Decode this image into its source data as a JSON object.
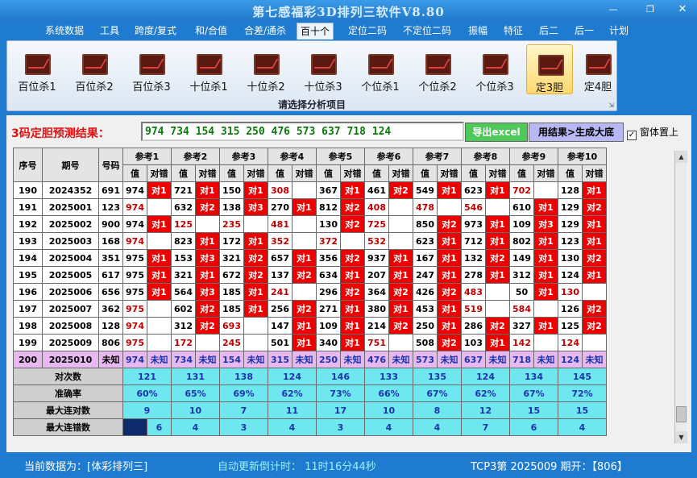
{
  "window": {
    "title": "第七感福彩3D排列三软件V8.80"
  },
  "menu": [
    "系统数据",
    "工具",
    "跨度/复式",
    "和/合值",
    "合差/通杀",
    "百十个",
    "定位二码",
    "不定位二码",
    "振幅",
    "特征",
    "后二",
    "后一",
    "计划"
  ],
  "active_menu": "百十个",
  "ribbon": {
    "buttons": [
      "百位杀1",
      "百位杀2",
      "百位杀3",
      "十位杀1",
      "十位杀2",
      "十位杀3",
      "个位杀1",
      "个位杀2",
      "个位杀3",
      "定3胆",
      "定4胆"
    ],
    "selected": "定3胆",
    "caption": "请选择分析项目"
  },
  "prediction": {
    "label": "3码定胆预测结果：",
    "value": "974 734 154 315 250 476 573 637 718 124"
  },
  "buttons": {
    "export": "导出excel",
    "gen": "用结果>生成大底"
  },
  "checkbox": {
    "label": "窗体置上",
    "checked": true
  },
  "table": {
    "h_seq": "序号",
    "h_period": "期号",
    "h_num": "号码",
    "refs": [
      "参考1",
      "参考2",
      "参考3",
      "参考4",
      "参考5",
      "参考6",
      "参考7",
      "参考8",
      "参考9",
      "参考10"
    ],
    "sub_val": "值",
    "sub_hit": "对错",
    "rows": [
      {
        "seq": "190",
        "period": "2024352",
        "num": "691",
        "cells": [
          [
            "974",
            "对1",
            0
          ],
          [
            "721",
            "对1",
            0
          ],
          [
            "150",
            "对1",
            0
          ],
          [
            "308",
            "",
            1
          ],
          [
            "367",
            "对1",
            0
          ],
          [
            "461",
            "对2",
            0
          ],
          [
            "549",
            "对1",
            0
          ],
          [
            "623",
            "对1",
            0
          ],
          [
            "702",
            "",
            1
          ],
          [
            "128",
            "对1",
            0
          ]
        ]
      },
      {
        "seq": "191",
        "period": "2025001",
        "num": "123",
        "cells": [
          [
            "974",
            "",
            1
          ],
          [
            "632",
            "对2",
            0
          ],
          [
            "138",
            "对3",
            0
          ],
          [
            "270",
            "对1",
            0
          ],
          [
            "812",
            "对2",
            0
          ],
          [
            "408",
            "",
            1
          ],
          [
            "478",
            "",
            1
          ],
          [
            "546",
            "",
            1
          ],
          [
            "610",
            "对1",
            0
          ],
          [
            "129",
            "对2",
            0
          ]
        ]
      },
      {
        "seq": "192",
        "period": "2025002",
        "num": "900",
        "cells": [
          [
            "974",
            "对1",
            0
          ],
          [
            "125",
            "",
            1
          ],
          [
            "235",
            "",
            1
          ],
          [
            "481",
            "",
            1
          ],
          [
            "130",
            "对2",
            0
          ],
          [
            "725",
            "",
            1
          ],
          [
            "850",
            "对2",
            0
          ],
          [
            "973",
            "对1",
            0
          ],
          [
            "109",
            "对3",
            0
          ],
          [
            "129",
            "对1",
            0
          ]
        ]
      },
      {
        "seq": "193",
        "period": "2025003",
        "num": "168",
        "cells": [
          [
            "974",
            "",
            1
          ],
          [
            "823",
            "对1",
            0
          ],
          [
            "172",
            "对1",
            0
          ],
          [
            "352",
            "",
            1
          ],
          [
            "372",
            "",
            1
          ],
          [
            "532",
            "",
            1
          ],
          [
            "623",
            "对1",
            0
          ],
          [
            "712",
            "对1",
            0
          ],
          [
            "802",
            "对1",
            0
          ],
          [
            "123",
            "对1",
            0
          ]
        ]
      },
      {
        "seq": "194",
        "period": "2025004",
        "num": "351",
        "cells": [
          [
            "975",
            "对1",
            0
          ],
          [
            "153",
            "对3",
            0
          ],
          [
            "321",
            "对2",
            0
          ],
          [
            "657",
            "对1",
            0
          ],
          [
            "356",
            "对2",
            0
          ],
          [
            "937",
            "对1",
            0
          ],
          [
            "167",
            "对1",
            0
          ],
          [
            "132",
            "对2",
            0
          ],
          [
            "149",
            "对1",
            0
          ],
          [
            "130",
            "对2",
            0
          ]
        ]
      },
      {
        "seq": "195",
        "period": "2025005",
        "num": "617",
        "cells": [
          [
            "975",
            "对1",
            0
          ],
          [
            "321",
            "对1",
            0
          ],
          [
            "672",
            "对2",
            0
          ],
          [
            "137",
            "对2",
            0
          ],
          [
            "634",
            "对1",
            0
          ],
          [
            "207",
            "对1",
            0
          ],
          [
            "247",
            "对1",
            0
          ],
          [
            "278",
            "对1",
            0
          ],
          [
            "312",
            "对1",
            0
          ],
          [
            "124",
            "对1",
            0
          ]
        ]
      },
      {
        "seq": "196",
        "period": "2025006",
        "num": "656",
        "cells": [
          [
            "975",
            "对1",
            0
          ],
          [
            "564",
            "对3",
            0
          ],
          [
            "185",
            "对1",
            0
          ],
          [
            "241",
            "",
            1
          ],
          [
            "296",
            "对2",
            0
          ],
          [
            "364",
            "对2",
            0
          ],
          [
            "426",
            "对2",
            0
          ],
          [
            "483",
            "",
            1
          ],
          [
            "50",
            "对1",
            0
          ],
          [
            "130",
            "",
            1
          ]
        ]
      },
      {
        "seq": "197",
        "period": "2025007",
        "num": "362",
        "cells": [
          [
            "975",
            "",
            1
          ],
          [
            "602",
            "对2",
            0
          ],
          [
            "185",
            "对1",
            0
          ],
          [
            "256",
            "对2",
            0
          ],
          [
            "271",
            "对1",
            0
          ],
          [
            "380",
            "对1",
            0
          ],
          [
            "453",
            "对1",
            0
          ],
          [
            "519",
            "",
            1
          ],
          [
            "584",
            "",
            1
          ],
          [
            "126",
            "对2",
            0
          ]
        ]
      },
      {
        "seq": "198",
        "period": "2025008",
        "num": "128",
        "cells": [
          [
            "974",
            "",
            1
          ],
          [
            "312",
            "对2",
            0
          ],
          [
            "693",
            "",
            1
          ],
          [
            "147",
            "对1",
            0
          ],
          [
            "109",
            "对1",
            0
          ],
          [
            "214",
            "对2",
            0
          ],
          [
            "250",
            "对1",
            0
          ],
          [
            "286",
            "对2",
            0
          ],
          [
            "327",
            "对1",
            0
          ],
          [
            "125",
            "对2",
            0
          ]
        ]
      },
      {
        "seq": "199",
        "period": "2025009",
        "num": "806",
        "cells": [
          [
            "975",
            "",
            1
          ],
          [
            "172",
            "",
            1
          ],
          [
            "245",
            "",
            1
          ],
          [
            "501",
            "对1",
            0
          ],
          [
            "340",
            "对1",
            0
          ],
          [
            "751",
            "",
            1
          ],
          [
            "508",
            "对2",
            0
          ],
          [
            "103",
            "对1",
            0
          ],
          [
            "142",
            "",
            1
          ],
          [
            "124",
            "",
            1
          ]
        ]
      }
    ],
    "pred_row": {
      "seq": "200",
      "period": "2025010",
      "num": "未知",
      "vals": [
        "974",
        "734",
        "154",
        "315",
        "250",
        "476",
        "573",
        "637",
        "718",
        "124"
      ],
      "unknown": "未知"
    },
    "stats": [
      {
        "label": "对次数",
        "vals": [
          "121",
          "131",
          "138",
          "124",
          "146",
          "133",
          "135",
          "124",
          "134",
          "145"
        ]
      },
      {
        "label": "准确率",
        "vals": [
          "60%",
          "65%",
          "69%",
          "62%",
          "73%",
          "66%",
          "67%",
          "62%",
          "67%",
          "72%"
        ]
      },
      {
        "label": "最大连对数",
        "vals": [
          "9",
          "10",
          "7",
          "11",
          "17",
          "10",
          "8",
          "12",
          "15",
          "15"
        ]
      },
      {
        "label": "最大连错数",
        "vals": [
          "6",
          "4",
          "3",
          "4",
          "3",
          "4",
          "4",
          "7",
          "6",
          "4"
        ]
      }
    ]
  },
  "status": {
    "current": "当前数据为：[体彩排列三]",
    "countdown": "自动更新倒计时：  11时16分44秒",
    "draw": "TCP3第 2025009 期开：【806】"
  }
}
